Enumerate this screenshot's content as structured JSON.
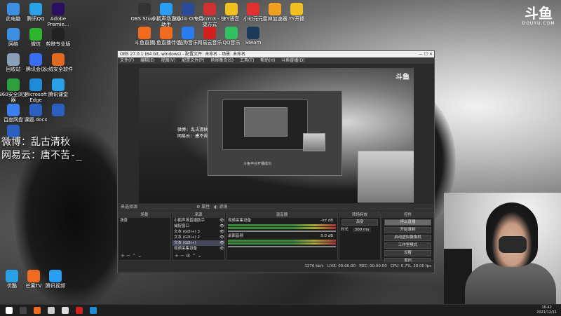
{
  "desktop": {
    "icons_left": [
      {
        "label": "此电脑",
        "color": "#3d8fe0"
      },
      {
        "label": "腾讯QQ",
        "color": "#2aa0e6"
      },
      {
        "label": "Adobe Premie...",
        "color": "#2a1060"
      },
      {
        "label": "网络",
        "color": "#3d8fe0"
      },
      {
        "label": "微信",
        "color": "#2cb52c"
      },
      {
        "label": "剪映专业版",
        "color": "#222222"
      },
      {
        "label": "回收站",
        "color": "#8aa0b8"
      },
      {
        "label": "腾讯会议",
        "color": "#3a6ef0"
      },
      {
        "label": "火绒安全软件",
        "color": "#e06a20"
      },
      {
        "label": "360安全浏览器",
        "color": "#2e9e3e"
      },
      {
        "label": "Microsoft Edge",
        "color": "#1f8bd6"
      },
      {
        "label": "腾讯课堂",
        "color": "#2aa0e6"
      },
      {
        "label": "百度网盘",
        "color": "#3e7ff0"
      },
      {
        "label": "课题.docx",
        "color": "#2b5fc0"
      },
      {
        "label": "",
        "color": "#2b5fc0"
      },
      {
        "label": "",
        "color": "#2b5fc0"
      }
    ],
    "icons_top": [
      {
        "label": "OBS Studio",
        "color": "#333333"
      },
      {
        "label": "小鹅声场直播助手",
        "color": "#2a9df4"
      },
      {
        "label": "Studio One 5",
        "color": "#2a4a9a"
      },
      {
        "label": "专用crm3 - 快捷方式",
        "color": "#d03030"
      },
      {
        "label": "YY语音",
        "color": "#f0c020"
      },
      {
        "label": "小幻元元",
        "color": "#e03030"
      },
      {
        "label": "雷神加速器",
        "color": "#f0a020"
      },
      {
        "label": "YY开播",
        "color": "#f0c020"
      },
      {
        "label": "斗鱼直播",
        "color": "#f06a20"
      },
      {
        "label": "斗鱼直播伴侣",
        "color": "#f06a20"
      },
      {
        "label": "酷狗音乐",
        "color": "#2a7df0"
      },
      {
        "label": "网易云音乐",
        "color": "#d02020"
      },
      {
        "label": "QQ音乐",
        "color": "#30c060"
      },
      {
        "label": "Steam",
        "color": "#1b3a5a"
      }
    ],
    "icons_bottom": [
      {
        "label": "优酷",
        "color": "#2aa0e6"
      },
      {
        "label": "芒果TV",
        "color": "#f06a20"
      },
      {
        "label": "腾讯视频",
        "color": "#2a9df4"
      }
    ],
    "logo": {
      "main": "斗鱼",
      "sub": "DOUYU.COM"
    },
    "overlay_lines": [
      "微博：乱古清秋",
      "网易云：唐不苦-_"
    ]
  },
  "obs": {
    "title": "OBS 27.0.1 (64 bit, windows) - 配置文件: 未命名 - 场景: 未命名",
    "menu": [
      "文件(F)",
      "编辑(E)",
      "视图(V)",
      "配置文件(P)",
      "场景集合(S)",
      "工具(T)",
      "帮助(H)",
      "斗鱼直播(D)"
    ],
    "preview_overlay_lines": [
      "微博: 乱古清秋",
      "网易云: 唐不苦"
    ],
    "preview_logo": "斗鱼",
    "nested_banner": "斗鱼平台开播成功",
    "scene_label": "来选择源",
    "scene_controls": [
      "属性",
      "滤镜"
    ],
    "docks": {
      "scenes": {
        "header": "场景",
        "items": [
          "场景"
        ]
      },
      "sources": {
        "header": "来源",
        "items": [
          "小鹅声场直播助手",
          "捕捉窗口",
          "文本 (GDI+) 3",
          "文本 (GDI+) 2",
          "文本 (GDI+)",
          "视频采集设备"
        ],
        "selected": 4
      },
      "mixer": {
        "header": "混音器",
        "channels": [
          {
            "name": "视频采集设备",
            "db": "-inf dB"
          },
          {
            "name": "桌面音频",
            "db": "0.0 dB"
          }
        ]
      },
      "transitions": {
        "header": "转场特效",
        "type": "渐变",
        "duration_label": "时长",
        "duration": "300 ms"
      },
      "controls": {
        "header": "控件",
        "buttons": [
          "停止直播",
          "开始录制",
          "启动虚拟摄像机",
          "工作室模式",
          "设置",
          "退出"
        ],
        "active": 0
      }
    },
    "status": {
      "live": "LIVE: 00:00:00",
      "rec": "REC: 00:00:00",
      "cpu": "CPU: 0.7%, 30.00 fps",
      "kbps": "1276 kb/s"
    }
  },
  "taskbar": {
    "icons": [
      {
        "name": "windows-start",
        "color": "#ffffff"
      },
      {
        "name": "obs",
        "color": "#444444"
      },
      {
        "name": "douyu",
        "color": "#f06a20"
      },
      {
        "name": "app3",
        "color": "#cccccc"
      },
      {
        "name": "app4",
        "color": "#dddddd"
      },
      {
        "name": "netease",
        "color": "#d02020"
      },
      {
        "name": "edge",
        "color": "#1f8bd6"
      }
    ],
    "time": "16:42",
    "date": "2021/12/11"
  }
}
